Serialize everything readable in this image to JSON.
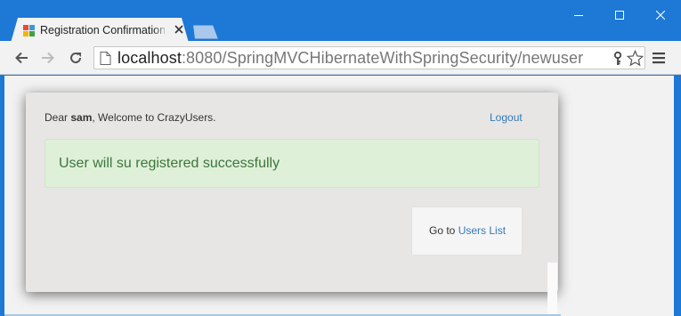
{
  "browser": {
    "tab": {
      "title": "Registration Confirmation",
      "favicon_icon": "spring-favicon-icon",
      "close_icon": "close-icon"
    },
    "new_tab_icon": "new-tab-icon",
    "window_controls": [
      "minimize-icon",
      "maximize-icon",
      "close-icon"
    ],
    "address_bar": {
      "host": "localhost",
      "path": ":8080/SpringMVCHibernateWithSpringSecurity/newuser"
    },
    "toolbar_icons": [
      "back-arrow-icon",
      "forward-arrow-icon",
      "reload-icon",
      "page-icon",
      "key-icon",
      "star-icon",
      "menu-icon"
    ]
  },
  "page": {
    "welcome": {
      "prefix": "Dear ",
      "user": "sam",
      "suffix": ", Welcome to CrazyUsers."
    },
    "logout_label": "Logout",
    "alert_message": "User will su registered successfully",
    "goto": {
      "prefix": "Go to ",
      "link": "Users List"
    }
  },
  "colors": {
    "title_bar": "#1d78d6",
    "link": "#337ab7",
    "success_bg": "#dff0d8",
    "success_text": "#3c763d"
  }
}
